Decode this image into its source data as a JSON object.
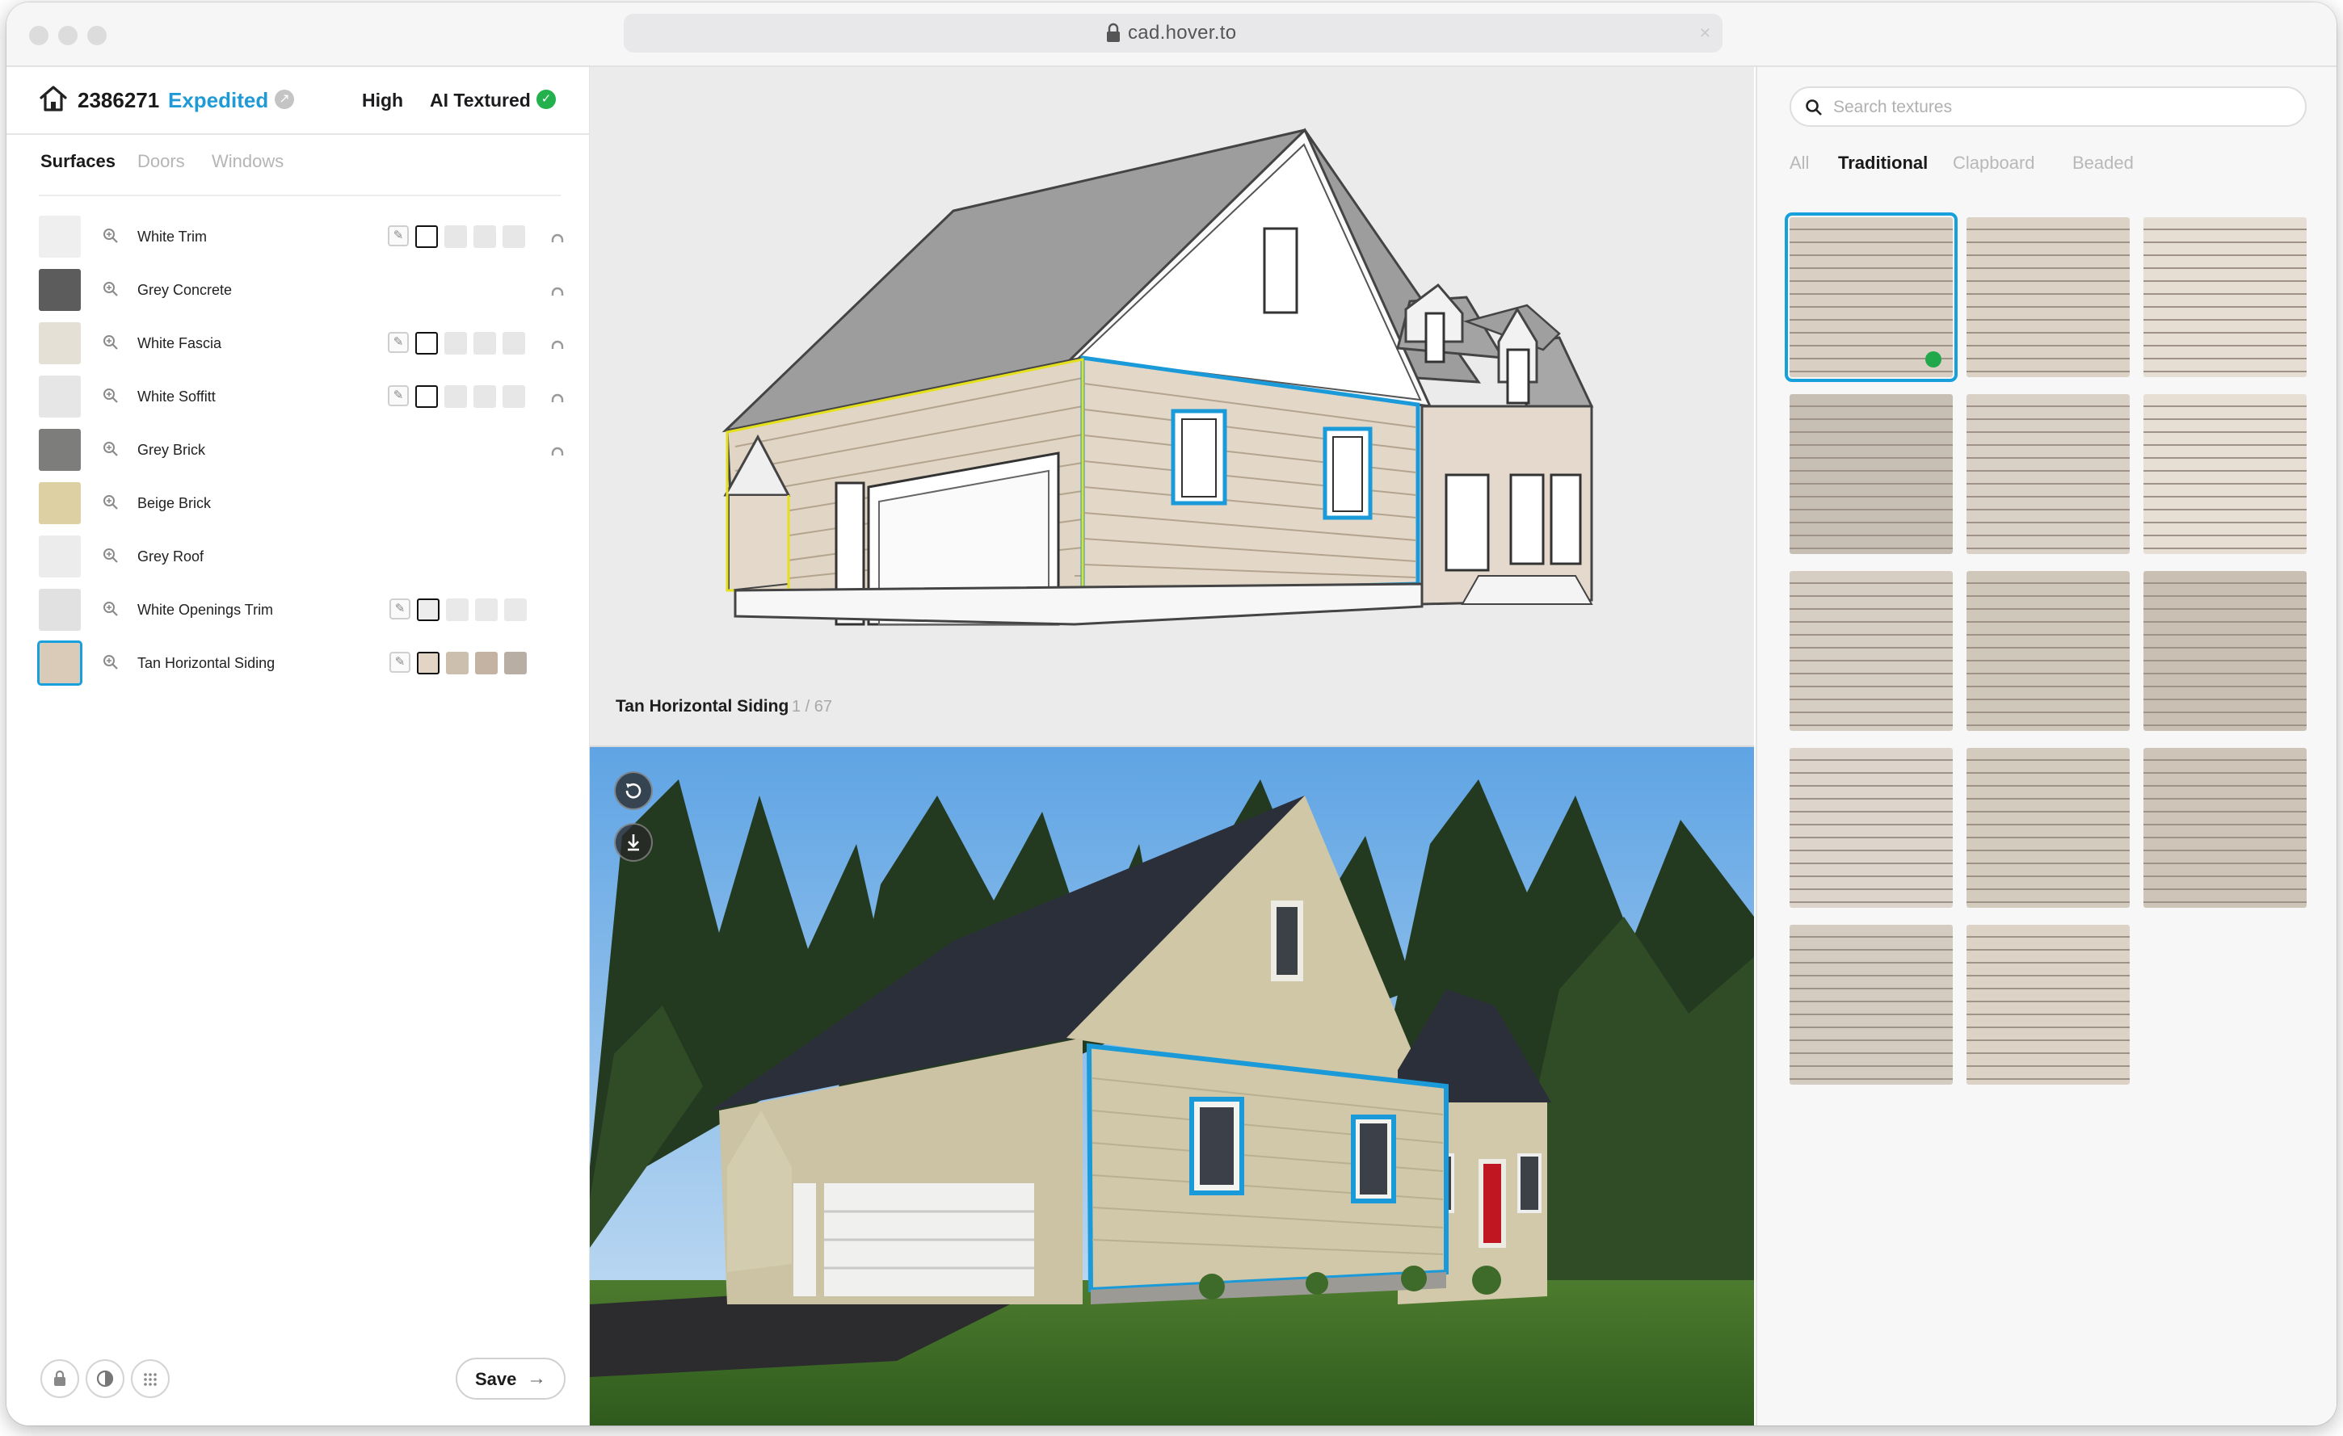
{
  "browser": {
    "url": "cad.hover.to"
  },
  "job": {
    "id": "2386271",
    "status": "Expedited",
    "quality": "High",
    "texture_mode": "AI Textured"
  },
  "left_tabs": [
    "Surfaces",
    "Doors",
    "Windows"
  ],
  "surfaces": [
    {
      "name": "White Trim",
      "swatch": "#efefef",
      "editable": true,
      "colors": [
        "#ffffff",
        "#e7e7e7",
        "#e7e7e7",
        "#e7e7e7"
      ],
      "linked": true
    },
    {
      "name": "Grey Concrete",
      "swatch": "#5c5c5c",
      "editable": false,
      "colors": [],
      "linked": true
    },
    {
      "name": "White Fascia",
      "swatch": "#e4e0d6",
      "editable": true,
      "colors": [
        "#ffffff",
        "#e7e7e7",
        "#e7e7e7",
        "#e7e7e7"
      ],
      "linked": true
    },
    {
      "name": "White Soffitt",
      "swatch": "#e6e6e6",
      "editable": true,
      "colors": [
        "#ffffff",
        "#e7e7e7",
        "#e7e7e7",
        "#e7e7e7"
      ],
      "linked": true
    },
    {
      "name": "Grey Brick",
      "swatch": "#7d7d7b",
      "editable": false,
      "colors": [],
      "linked": true
    },
    {
      "name": "Beige Brick",
      "swatch": "#ddd1a4",
      "editable": false,
      "colors": [],
      "linked": false
    },
    {
      "name": "Grey Roof",
      "swatch": "#ececec",
      "editable": false,
      "colors": [],
      "linked": false
    },
    {
      "name": "White Openings Trim",
      "swatch": "#e1e1e1",
      "editable": true,
      "colors": [
        "#ededed",
        "#e9e9e9",
        "#e9e9e9",
        "#e9e9e9"
      ],
      "linked": false
    },
    {
      "name": "Tan Horizontal Siding",
      "swatch": "#d9cbb8",
      "editable": true,
      "colors": [
        "#e3d5c6",
        "#cdbfae",
        "#c4b3a2",
        "#b9aea4"
      ],
      "linked": false
    }
  ],
  "footer": {
    "save_label": "Save"
  },
  "model": {
    "selected_surface": "Tan Horizontal Siding",
    "count": "1 / 67"
  },
  "textures": {
    "search_placeholder": "Search textures",
    "tabs": [
      "All",
      "Traditional",
      "Clapboard",
      "Beaded"
    ],
    "tiles": [
      {
        "color": "#d9d0c3"
      },
      {
        "color": "#dcd2c6"
      },
      {
        "color": "#e6ddd3"
      },
      {
        "color": "#c7bfb3"
      },
      {
        "color": "#dad1c6"
      },
      {
        "color": "#e7ded4"
      },
      {
        "color": "#d6cec2"
      },
      {
        "color": "#d0c7bb"
      },
      {
        "color": "#c9c0b3"
      },
      {
        "color": "#ddd5cb"
      },
      {
        "color": "#d4cbbf"
      },
      {
        "color": "#cec4b8"
      },
      {
        "color": "#d4ccc0"
      },
      {
        "color": "#dcd2c5"
      }
    ]
  },
  "colors": {
    "accent": "#1f9ad6",
    "selection": "#18a0dc",
    "success": "#22b14c"
  }
}
